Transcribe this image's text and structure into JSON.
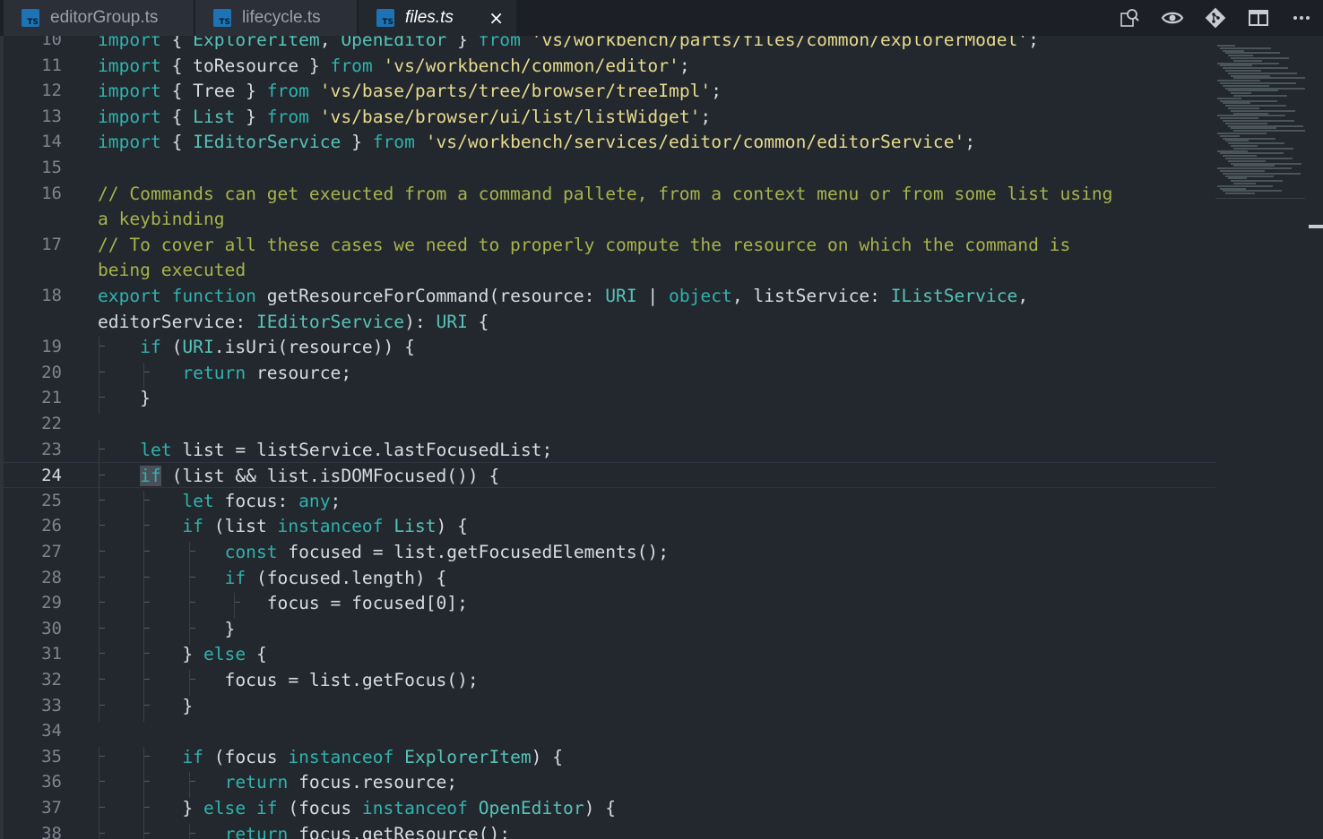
{
  "tabs": [
    {
      "name": "editorGroup.ts",
      "icon": "typescript-file-icon",
      "icon_text": "TS"
    },
    {
      "name": "lifecycle.ts",
      "icon": "typescript-file-icon",
      "icon_text": "TS"
    },
    {
      "name": "files.ts",
      "icon": "typescript-file-icon",
      "icon_text": "TS",
      "active": true,
      "close": "×"
    }
  ],
  "toolbar": [
    {
      "name": "find-references-icon"
    },
    {
      "name": "compare-changes-icon"
    },
    {
      "name": "git-icon"
    },
    {
      "name": "split-editor-icon"
    },
    {
      "name": "more-actions-icon"
    }
  ],
  "editor": {
    "current_line": "24",
    "lines": [
      {
        "num": "10",
        "text": "import { ExplorerItem, OpenEditor } from 'vs/workbench/parts/files/common/explorerModel';"
      },
      {
        "num": "11",
        "text": "import { toResource } from 'vs/workbench/common/editor';"
      },
      {
        "num": "12",
        "text": "import { Tree } from 'vs/base/parts/tree/browser/treeImpl';"
      },
      {
        "num": "13",
        "text": "import { List } from 'vs/base/browser/ui/list/listWidget';"
      },
      {
        "num": "14",
        "text": "import { IEditorService } from 'vs/workbench/services/editor/common/editorService';"
      },
      {
        "num": "15",
        "text": ""
      },
      {
        "num": "16",
        "text": "// Commands can get exeucted from a command pallete, from a context menu or from some list using"
      },
      {
        "num": "",
        "text": "a keybinding"
      },
      {
        "num": "17",
        "text": "// To cover all these cases we need to properly compute the resource on which the command is"
      },
      {
        "num": "",
        "text": "being executed"
      },
      {
        "num": "18",
        "text": "export function getResourceForCommand(resource: URI | object, listService: IListService,"
      },
      {
        "num": "",
        "text": "editorService: IEditorService): URI {"
      },
      {
        "num": "19",
        "text": "    if (URI.isUri(resource)) {"
      },
      {
        "num": "20",
        "text": "        return resource;"
      },
      {
        "num": "21",
        "text": "    }"
      },
      {
        "num": "22",
        "text": ""
      },
      {
        "num": "23",
        "text": "    let list = listService.lastFocusedList;"
      },
      {
        "num": "24",
        "text": "    if (list && list.isDOMFocused()) {"
      },
      {
        "num": "25",
        "text": "        let focus: any;"
      },
      {
        "num": "26",
        "text": "        if (list instanceof List) {"
      },
      {
        "num": "27",
        "text": "            const focused = list.getFocusedElements();"
      },
      {
        "num": "28",
        "text": "            if (focused.length) {"
      },
      {
        "num": "29",
        "text": "                focus = focused[0];"
      },
      {
        "num": "30",
        "text": "            }"
      },
      {
        "num": "31",
        "text": "        } else {"
      },
      {
        "num": "32",
        "text": "            focus = list.getFocus();"
      },
      {
        "num": "33",
        "text": "        }"
      },
      {
        "num": "34",
        "text": ""
      },
      {
        "num": "35",
        "text": "        if (focus instanceof ExplorerItem) {"
      },
      {
        "num": "36",
        "text": "            return focus.resource;"
      },
      {
        "num": "37",
        "text": "        } else if (focus instanceof OpenEditor) {"
      },
      {
        "num": "38",
        "text": "            return focus.getResource();"
      }
    ]
  },
  "colors": {
    "background": "#23272e",
    "keyword": "#2fb3ae",
    "string": "#e6db8c",
    "comment": "#a8b34a",
    "type": "#55c3b9",
    "text": "#d7dce3"
  }
}
